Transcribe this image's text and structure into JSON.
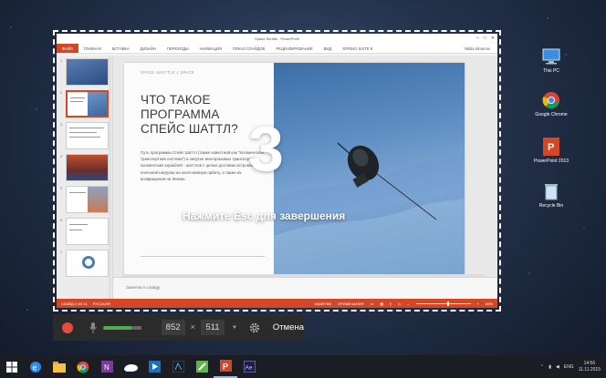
{
  "app": {
    "window_title": "Space Shuttle - PowerPoint",
    "ribbon_tabs": [
      "ФАЙЛ",
      "ГЛАВНАЯ",
      "ВСТАВКА",
      "ДИЗАЙН",
      "ПЕРЕХОДЫ",
      "АНИМАЦИЯ",
      "ПОКАЗ СЛАЙДОВ",
      "РЕЦЕНЗИРОВАНИЕ",
      "ВИД",
      "SPRING SUITE 8"
    ],
    "user_name": "Nikita Simonov",
    "slide_numbers": [
      "1",
      "2",
      "3",
      "4",
      "5",
      "6",
      "7"
    ],
    "slide": {
      "caption": "Space Shuttle 1 Space",
      "title": "ЧТО ТАКОЕ ПРОГРАММА СПЕЙС ШАТТЛ?",
      "body": "Суть программы Спейс Шаттл (также известной как \"Космическая транспортная система\") в запуске многоразовых транспортных космических кораблей - шаттлов с целью доставки астронавтов и полезной нагрузки на околоземную орбиту, а также их возвращения на Землю."
    },
    "notes_label": "Заметки к слайду",
    "status": {
      "slide_info": "СЛАЙД 2 ИЗ 11",
      "lang": "РУССКИЙ",
      "notes_btn": "ЗАМЕТКИ",
      "comments_btn": "ПРИМЕЧАНИЯ",
      "zoom": "66%"
    }
  },
  "overlay": {
    "countdown": "3",
    "hint": "Нажмите Esc для завершения"
  },
  "recorder": {
    "width": "852",
    "times": "×",
    "height": "511",
    "cancel_label": "Отмена"
  },
  "desktop_icons": [
    {
      "label": "This PC",
      "icon": "pc-icon"
    },
    {
      "label": "Google Chrome",
      "icon": "chrome-icon"
    },
    {
      "label": "PowerPoint 2013",
      "icon": "powerpoint-icon"
    },
    {
      "label": "Recycle Bin",
      "icon": "recycle-bin-icon"
    }
  ],
  "taskbar": {
    "lang": "ENG",
    "time": "14:56",
    "date": "11.11.2015"
  },
  "colors": {
    "accent": "#d24726",
    "record": "#e74c3c",
    "mic_level": "#4caf50"
  }
}
